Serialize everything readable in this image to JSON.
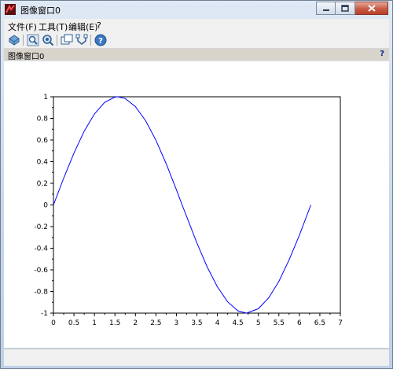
{
  "window": {
    "title": "图像窗口0"
  },
  "menu": [
    {
      "label": "文件(F)"
    },
    {
      "label": "工具(T)"
    },
    {
      "label": "编辑(E)"
    },
    {
      "label": "?"
    }
  ],
  "toolbar": {
    "icons": [
      "rotate-icon",
      "zoom-icon",
      "zoom-area-icon",
      "datatip-icon",
      "datatip-edit-icon",
      "help-icon"
    ]
  },
  "panel": {
    "title": "图像窗口0",
    "help": "?"
  },
  "chart_data": {
    "type": "line",
    "title": "",
    "xlabel": "",
    "ylabel": "",
    "xlim": [
      0,
      7
    ],
    "ylim": [
      -1,
      1
    ],
    "x_ticks": [
      "0",
      "0.5",
      "1",
      "1.5",
      "2",
      "2.5",
      "3",
      "3.5",
      "4",
      "4.5",
      "5",
      "5.5",
      "6",
      "6.5",
      "7"
    ],
    "y_ticks": [
      "1",
      "0.8",
      "0.6",
      "0.4",
      "0.2",
      "0",
      "-0.2",
      "-0.4",
      "-0.6",
      "-0.8",
      "-1"
    ],
    "grid": false,
    "series": [
      {
        "color": "#0000ff",
        "x": [
          0,
          0.25,
          0.5,
          0.75,
          1,
          1.25,
          1.5,
          1.57,
          1.75,
          2,
          2.25,
          2.5,
          2.75,
          3,
          3.14,
          3.25,
          3.5,
          3.75,
          4,
          4.25,
          4.5,
          4.71,
          5,
          5.25,
          5.5,
          5.75,
          6,
          6.28
        ],
        "y": [
          0,
          0.247,
          0.479,
          0.682,
          0.841,
          0.949,
          0.997,
          1,
          0.984,
          0.909,
          0.778,
          0.598,
          0.382,
          0.141,
          0,
          -0.108,
          -0.351,
          -0.572,
          -0.757,
          -0.895,
          -0.978,
          -1,
          -0.959,
          -0.859,
          -0.706,
          -0.508,
          -0.279,
          0
        ]
      }
    ]
  }
}
